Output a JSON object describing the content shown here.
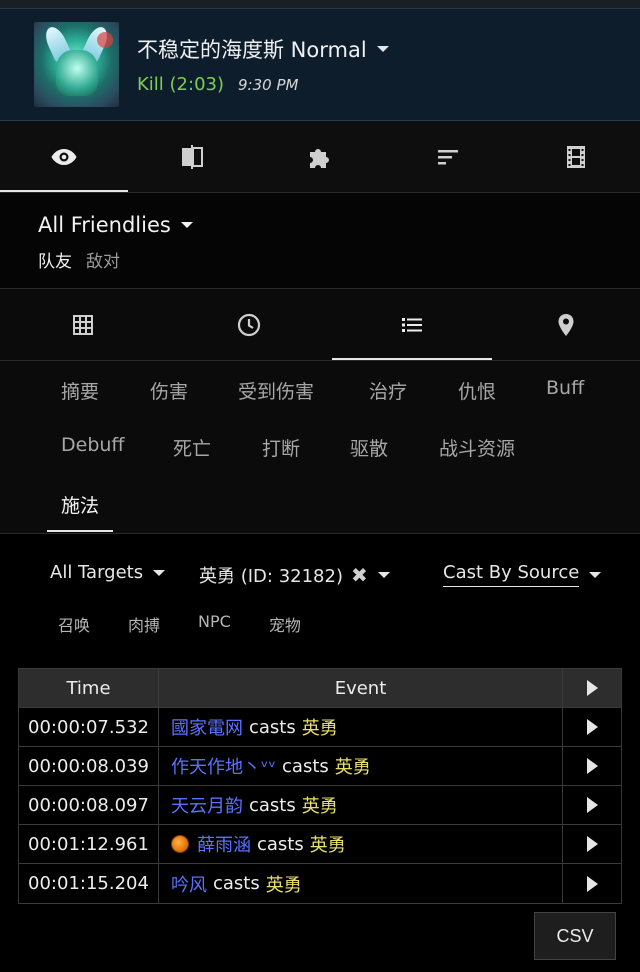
{
  "fight": {
    "boss_name": "不稳定的海度斯 Normal",
    "result": "Kill (2:03)",
    "time": "9:30 PM"
  },
  "main_tabs": [
    {
      "icon": "eye-icon",
      "active": true
    },
    {
      "icon": "compare-icon",
      "active": false
    },
    {
      "icon": "puzzle-icon",
      "active": false
    },
    {
      "icon": "sort-icon",
      "active": false
    },
    {
      "icon": "film-icon",
      "active": false
    }
  ],
  "friendlies": {
    "title": "All Friendlies",
    "team": "队友",
    "enemy": "敌对"
  },
  "sub_tabs": [
    {
      "icon": "grid-icon",
      "active": false
    },
    {
      "icon": "clock-icon",
      "active": false
    },
    {
      "icon": "list-icon",
      "active": true
    },
    {
      "icon": "map-pin-icon",
      "active": false
    }
  ],
  "categories": [
    "摘要",
    "伤害",
    "受到伤害",
    "治疗",
    "仇恨",
    "Buff",
    "Debuff",
    "死亡",
    "打断",
    "驱散",
    "战斗资源",
    "施法"
  ],
  "active_category": "施法",
  "filters": {
    "targets": "All Targets",
    "ability": "英勇 (ID: 32182)",
    "mode": "Cast By Source"
  },
  "pet_filters": [
    "召唤",
    "肉搏",
    "NPC",
    "宠物"
  ],
  "table": {
    "headers": {
      "time": "Time",
      "event": "Event"
    },
    "rows": [
      {
        "time": "00:00:07.532",
        "source": "國家電网",
        "verb": "casts",
        "target": "英勇",
        "spec_icon": false
      },
      {
        "time": "00:00:08.039",
        "source": "作天作地丶ᵛᵛ",
        "verb": "casts",
        "target": "英勇",
        "spec_icon": false
      },
      {
        "time": "00:00:08.097",
        "source": "天云月韵",
        "verb": "casts",
        "target": "英勇",
        "spec_icon": false
      },
      {
        "time": "00:01:12.961",
        "source": "薛雨涵",
        "verb": "casts",
        "target": "英勇",
        "spec_icon": true
      },
      {
        "time": "00:01:15.204",
        "source": "吟风",
        "verb": "casts",
        "target": "英勇",
        "spec_icon": false
      }
    ]
  },
  "csv_label": "CSV",
  "colors": {
    "header_bg": "#0d1d2c",
    "kill_green": "#7dce55",
    "source_blue": "#5b72ff",
    "target_yellow": "#e8e06a"
  }
}
